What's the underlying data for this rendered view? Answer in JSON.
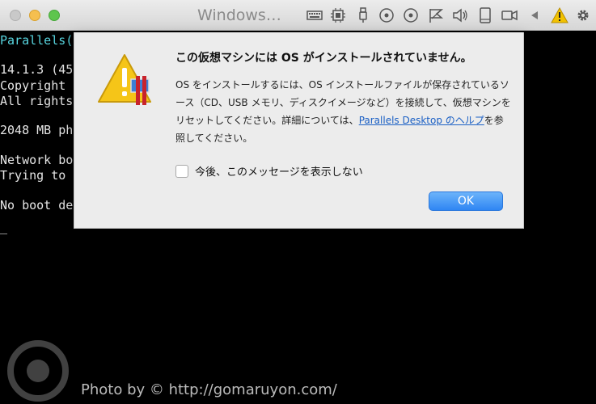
{
  "window": {
    "title": "Windows…",
    "toolbar_icons": [
      "keyboard-icon",
      "cpu-icon",
      "usb-icon",
      "disc-icon",
      "disc2-icon",
      "network-icon",
      "speaker-icon",
      "device-icon",
      "camera-icon",
      "arrow-left-icon",
      "warning-icon",
      "gear-icon"
    ]
  },
  "terminal": {
    "lines": [
      "Parallels(",
      "14.1.3 (45",
      "Copyright",
      "All rights",
      "2048 MB ph",
      "Network bo",
      "Trying to",
      "No boot de",
      "_"
    ]
  },
  "dialog": {
    "title": "この仮想マシンには OS がインストールされていません。",
    "body_part1": "OS をインストールするには、OS インストールファイルが保存されているソース（CD、USB メモリ、ディスクイメージなど）を接続して、仮想マシンをリセットしてください。詳細については、",
    "link_text": "Parallels Desktop のヘルプ",
    "body_part2": "を参照してください。",
    "checkbox_label": "今後、このメッセージを表示しない",
    "ok_label": "OK"
  },
  "watermark": {
    "text": "Photo by © http://gomaruyon.com/"
  },
  "colors": {
    "accent": "#2f86f3",
    "terminal_cyan": "#58d6e0",
    "link": "#1a5fc4"
  }
}
